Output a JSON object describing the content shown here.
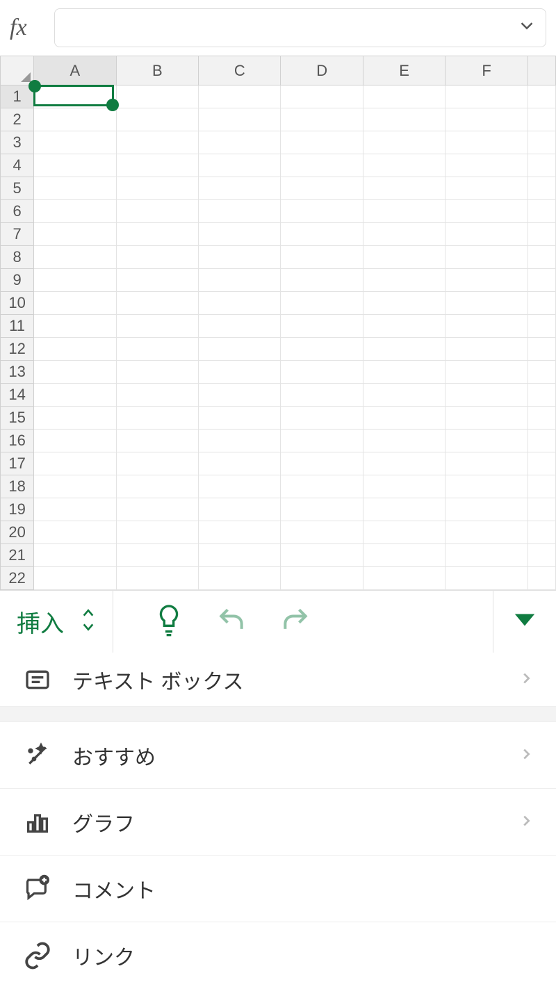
{
  "formula_bar": {
    "fx_label": "fx",
    "value": ""
  },
  "grid": {
    "columns": [
      "A",
      "B",
      "C",
      "D",
      "E",
      "F"
    ],
    "rows": [
      "1",
      "2",
      "3",
      "4",
      "5",
      "6",
      "7",
      "8",
      "9",
      "10",
      "11",
      "12",
      "13",
      "14",
      "15",
      "16",
      "17",
      "18",
      "19",
      "20",
      "21",
      "22"
    ],
    "selected_column_index": 0,
    "selected_row_index": 0
  },
  "toolbar": {
    "tab_label": "挿入"
  },
  "menu": {
    "text_box": "テキスト ボックス",
    "recommended": "おすすめ",
    "chart": "グラフ",
    "comment": "コメント",
    "link": "リンク"
  },
  "colors": {
    "accent": "#107c41"
  }
}
